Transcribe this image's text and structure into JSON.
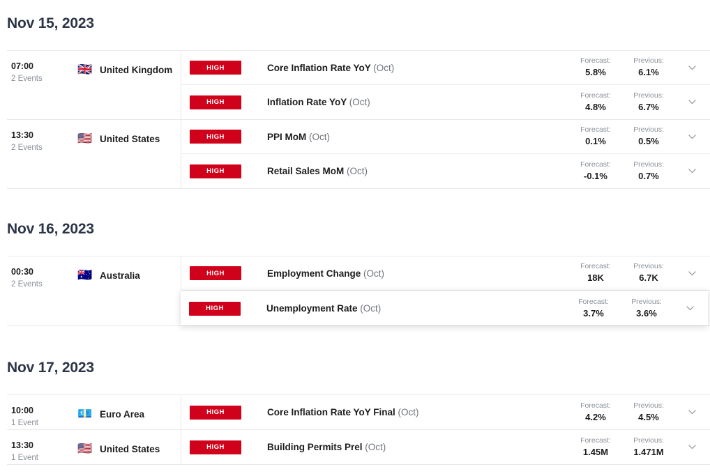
{
  "labels": {
    "forecast": "Forecast:",
    "previous": "Previous:",
    "impact_high": "HIGH",
    "expand_icon": "chevron-down-icon"
  },
  "colors": {
    "impact_high": "#d0011b",
    "heading": "#2c3547",
    "muted": "#8a8f98",
    "border": "#e8e9eb",
    "text": "#1d1d1d"
  },
  "days": [
    {
      "date": "Nov 15, 2023",
      "groups": [
        {
          "time": "07:00",
          "event_count": "2 Events",
          "country": "United Kingdom",
          "flag": "🇬🇧",
          "events": [
            {
              "impact": "HIGH",
              "title": "Core Inflation Rate YoY",
              "period": "(Oct)",
              "forecast": "5.8%",
              "previous": "6.1%",
              "hovered": false
            },
            {
              "impact": "HIGH",
              "title": "Inflation Rate YoY",
              "period": "(Oct)",
              "forecast": "4.8%",
              "previous": "6.7%",
              "hovered": false
            }
          ]
        },
        {
          "time": "13:30",
          "event_count": "2 Events",
          "country": "United States",
          "flag": "🇺🇸",
          "events": [
            {
              "impact": "HIGH",
              "title": "PPI MoM",
              "period": "(Oct)",
              "forecast": "0.1%",
              "previous": "0.5%",
              "hovered": false
            },
            {
              "impact": "HIGH",
              "title": "Retail Sales MoM",
              "period": "(Oct)",
              "forecast": "-0.1%",
              "previous": "0.7%",
              "hovered": false
            }
          ]
        }
      ]
    },
    {
      "date": "Nov 16, 2023",
      "groups": [
        {
          "time": "00:30",
          "event_count": "2 Events",
          "country": "Australia",
          "flag": "🇦🇺",
          "events": [
            {
              "impact": "HIGH",
              "title": "Employment Change",
              "period": "(Oct)",
              "forecast": "18K",
              "previous": "6.7K",
              "hovered": false
            },
            {
              "impact": "HIGH",
              "title": "Unemployment Rate",
              "period": "(Oct)",
              "forecast": "3.7%",
              "previous": "3.6%",
              "hovered": true
            }
          ]
        }
      ]
    },
    {
      "date": "Nov 17, 2023",
      "groups": [
        {
          "time": "10:00",
          "event_count": "1 Event",
          "country": "Euro Area",
          "flag": "💶",
          "events": [
            {
              "impact": "HIGH",
              "title": "Core Inflation Rate YoY Final",
              "period": "(Oct)",
              "forecast": "4.2%",
              "previous": "4.5%",
              "hovered": false
            }
          ]
        },
        {
          "time": "13:30",
          "event_count": "1 Event",
          "country": "United States",
          "flag": "🇺🇸",
          "events": [
            {
              "impact": "HIGH",
              "title": "Building Permits Prel",
              "period": "(Oct)",
              "forecast": "1.45M",
              "previous": "1.471M",
              "hovered": false
            }
          ]
        }
      ]
    }
  ]
}
